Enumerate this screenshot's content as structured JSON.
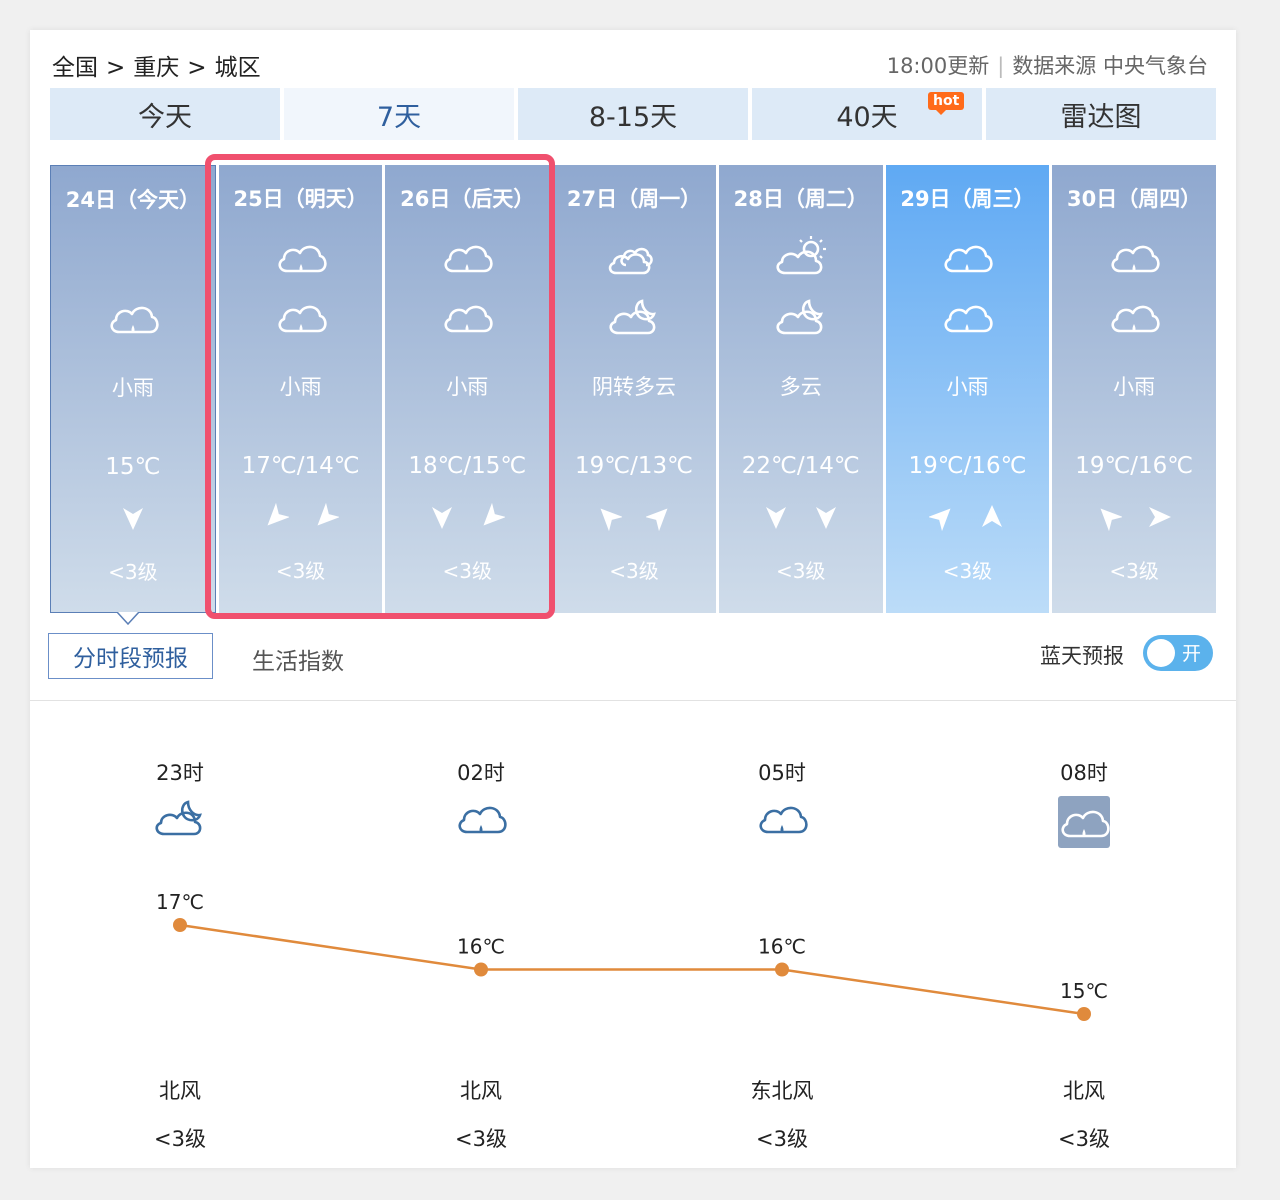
{
  "breadcrumb": [
    "全国",
    "重庆",
    "城区"
  ],
  "breadcrumb_sep": ">",
  "update": {
    "time": "18:00更新",
    "source": "数据来源 中央气象台"
  },
  "tabs": [
    {
      "label": "今天"
    },
    {
      "label": "7天",
      "active": true
    },
    {
      "label": "8-15天"
    },
    {
      "label": "40天",
      "badge": "hot"
    },
    {
      "label": "雷达图"
    }
  ],
  "days": [
    {
      "date": "24日（今天）",
      "icons": [
        "cloud-rain-icon"
      ],
      "condition": "小雨",
      "temp": "15℃",
      "winds": [
        0
      ],
      "level": "<3级"
    },
    {
      "date": "25日（明天）",
      "icons": [
        "cloud-rain-icon",
        "cloud-rain-icon"
      ],
      "condition": "小雨",
      "temp": "17℃/14℃",
      "winds": [
        45,
        45
      ],
      "level": "<3级"
    },
    {
      "date": "26日（后天）",
      "icons": [
        "cloud-rain-icon",
        "cloud-rain-icon"
      ],
      "condition": "小雨",
      "temp": "18℃/15℃",
      "winds": [
        0,
        45
      ],
      "level": "<3级"
    },
    {
      "date": "27日（周一）",
      "icons": [
        "overcast-icon",
        "partly-cloudy-night-icon"
      ],
      "condition": "阴转多云",
      "temp": "19℃/13℃",
      "winds": [
        135,
        225
      ],
      "level": "<3级"
    },
    {
      "date": "28日（周二）",
      "icons": [
        "partly-cloudy-day-icon",
        "partly-cloudy-night-icon"
      ],
      "condition": "多云",
      "temp": "22℃/14℃",
      "winds": [
        0,
        0
      ],
      "level": "<3级"
    },
    {
      "date": "29日（周三）",
      "icons": [
        "cloud-rain-icon",
        "cloud-rain-icon"
      ],
      "condition": "小雨",
      "temp": "19℃/16℃",
      "winds": [
        225,
        180
      ],
      "level": "<3级"
    },
    {
      "date": "30日（周四）",
      "icons": [
        "cloud-rain-icon",
        "cloud-rain-icon"
      ],
      "condition": "小雨",
      "temp": "19℃/16℃",
      "winds": [
        135,
        270
      ],
      "level": "<3级"
    }
  ],
  "subtabs": [
    "分时段预报",
    "生活指数"
  ],
  "sky_forecast": {
    "label": "蓝天预报",
    "toggle": "开"
  },
  "hourly": [
    {
      "time": "23时",
      "icon": "partly-cloudy-night-icon",
      "temp_value": 17,
      "temp": "17℃",
      "wind": "北风",
      "level": "<3级"
    },
    {
      "time": "02时",
      "icon": "cloud-rain-icon",
      "temp_value": 16,
      "temp": "16℃",
      "wind": "北风",
      "level": "<3级"
    },
    {
      "time": "05时",
      "icon": "cloud-rain-icon",
      "temp_value": 16,
      "temp": "16℃",
      "wind": "东北风",
      "level": "<3级"
    },
    {
      "time": "08时",
      "icon": "cloud-rain-icon",
      "temp_value": 15,
      "temp": "15℃",
      "wind": "北风",
      "level": "<3级"
    }
  ],
  "chart_data": {
    "type": "line",
    "x": [
      "23时",
      "02时",
      "05时",
      "08时"
    ],
    "series": [
      {
        "values": [
          17,
          16,
          16,
          15
        ]
      }
    ],
    "color": "#e08a3c"
  },
  "colors": {
    "accent": "#2f5f9e",
    "highlight_box": "#f0506e",
    "toggle": "#5bb2ec",
    "line": "#e08a3c"
  }
}
